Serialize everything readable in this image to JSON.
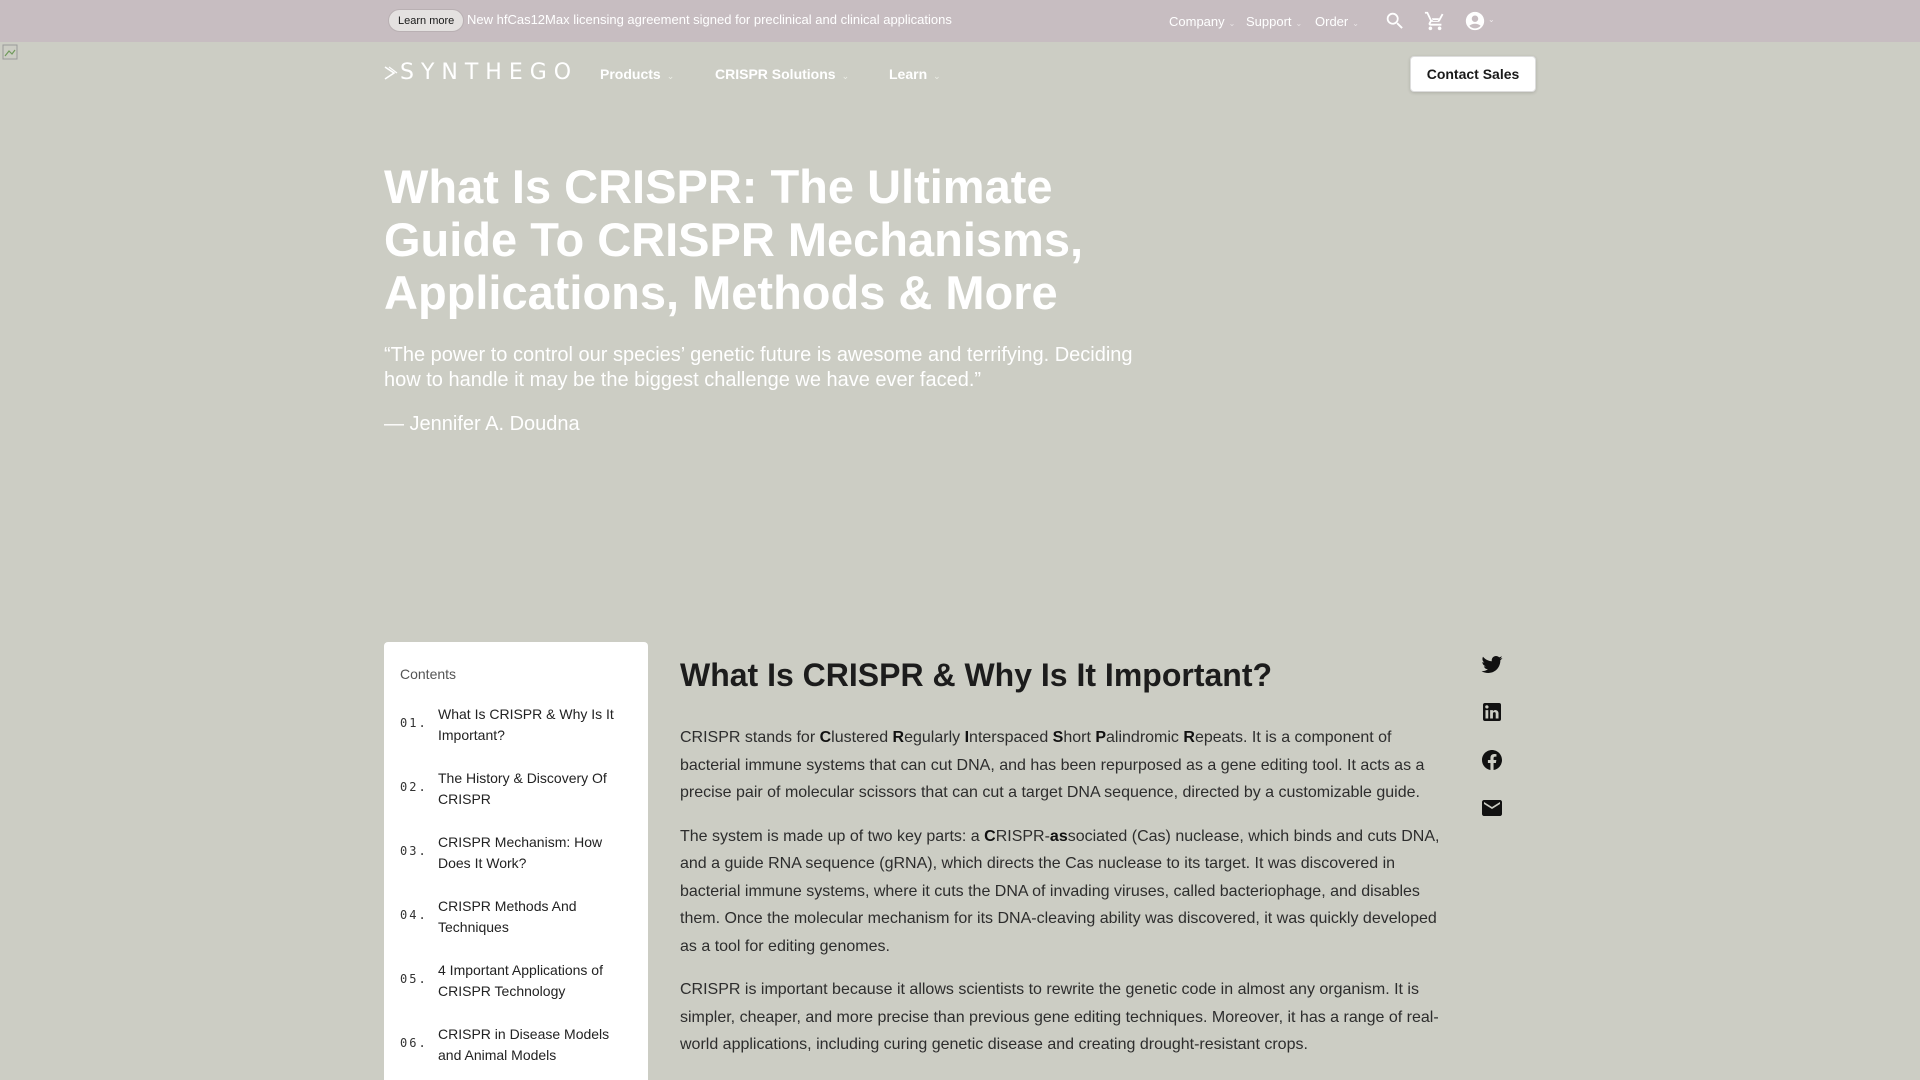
{
  "announcement": {
    "pill_label": "Learn more",
    "text": "New hfCas12Max licensing agreement signed for preclinical and clinical applications"
  },
  "utility_nav": {
    "company": "Company",
    "support": "Support",
    "order": "Order"
  },
  "brand": {
    "logo_text": "SYNTHEGO"
  },
  "main_nav": {
    "products": "Products",
    "crispr_solutions": "CRISPR Solutions",
    "learn": "Learn",
    "contact_sales": "Contact Sales"
  },
  "hero": {
    "title": "What Is CRISPR: The Ultimate Guide To CRISPR Mechanisms, Applications, Methods & More",
    "quote": "“The power to control our species’ genetic future is awesome and terrifying. Deciding how to handle it may be the biggest challenge we have ever faced.”",
    "author": "— Jennifer A. Doudna"
  },
  "toc": {
    "title": "Contents",
    "items": [
      {
        "num": "01.",
        "label": "What Is CRISPR & Why Is It Important?"
      },
      {
        "num": "02.",
        "label": "The History & Discovery Of CRISPR"
      },
      {
        "num": "03.",
        "label": "CRISPR Mechanism: How Does It Work?"
      },
      {
        "num": "04.",
        "label": "CRISPR Methods And Techniques"
      },
      {
        "num": "05.",
        "label": "4 Important Applications of CRISPR Technology"
      },
      {
        "num": "06.",
        "label": "CRISPR in Disease Models and Animal Models"
      }
    ]
  },
  "article": {
    "heading": "What Is CRISPR & Why Is It Important?",
    "p1": {
      "a": "CRISPR stands for ",
      "C": "C",
      "c_rest": "lustered ",
      "R": "R",
      "r_rest": "egularly ",
      "I": "I",
      "i_rest": "nterspaced ",
      "S": "S",
      "s_rest": "hort ",
      "P": "P",
      "p_rest": "alindromic ",
      "R2": "R",
      "r2_rest": "epeats. It is a component of bacterial immune systems that can cut DNA, and has been repurposed as a gene editing tool. It acts as a precise pair of molecular scissors that can cut a target DNA sequence, directed by a customizable guide."
    },
    "p2": {
      "a": "The system is made up of two key parts: a ",
      "C": "C",
      "mid": "RISPR-",
      "as": "as",
      "rest": "sociated (Cas) nuclease, which binds and cuts DNA, and a guide RNA sequence (gRNA), which directs the Cas nuclease to its target. It was discovered in bacterial immune systems, where it cuts the DNA of invading viruses, called bacteriophage, and disables them. Once the molecular mechanism for its DNA-cleaving ability was discovered, it was quickly developed as a tool for editing genomes."
    },
    "p3": "CRISPR is important because it allows scientists to rewrite the genetic code in almost any organism. It is simpler, cheaper, and more precise than previous gene editing techniques. Moreover, it has a range of real-world applications, including curing genetic disease and creating drought-resistant crops."
  },
  "share": [
    "twitter-icon",
    "linkedin-icon",
    "facebook-icon",
    "email-icon"
  ],
  "colors": {
    "announcement_bg": "#c7bdc1",
    "page_bg": "#cccdc4",
    "card_bg": "#ffffff"
  }
}
